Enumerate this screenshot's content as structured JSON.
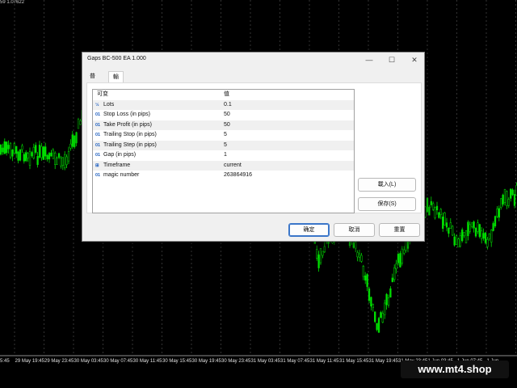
{
  "chart": {
    "top_readout": "59 1.07622",
    "time_labels": [
      "5:45",
      "29 May 19:45",
      "29 May 23:45",
      "30 May 03:45",
      "30 May 07:45",
      "30 May 11:45",
      "30 May 15:45",
      "30 May 19:45",
      "30 May 23:45",
      "31 May 03:45",
      "31 May 07:45",
      "31 May 11:45",
      "31 May 15:45",
      "31 May 19:45",
      "31 May 23:45",
      "1 Jun 03:45",
      "1 Jun 07:45",
      "1 Jun"
    ],
    "bull_color": "#00e000"
  },
  "watermark": "www.mt4.shop",
  "dialog": {
    "title": "Gaps BC-500 EA 1.000",
    "controls": {
      "minimize": "—",
      "maximize": "☐",
      "close": "✕"
    },
    "tabs": [
      "普通",
      "輸入"
    ],
    "active_tab": "輸入",
    "columns": {
      "variable": "可变",
      "value": "值"
    },
    "params": [
      {
        "icon": "½",
        "icon_name": "double-icon",
        "name": "Lots",
        "value": "0.1"
      },
      {
        "icon": "01",
        "icon_name": "integer-icon",
        "name": "Stop Loss (in pips)",
        "value": "50"
      },
      {
        "icon": "01",
        "icon_name": "integer-icon",
        "name": "Take Profit (in pips)",
        "value": "50"
      },
      {
        "icon": "01",
        "icon_name": "integer-icon",
        "name": "Trailing Stop (in pips)",
        "value": "5"
      },
      {
        "icon": "01",
        "icon_name": "integer-icon",
        "name": "Trailing Step (in pips)",
        "value": "5"
      },
      {
        "icon": "01",
        "icon_name": "integer-icon",
        "name": "Gap (in pips)",
        "value": "1"
      },
      {
        "icon": "⊞",
        "icon_name": "enum-icon",
        "name": "Timeframe",
        "value": "current"
      },
      {
        "icon": "01",
        "icon_name": "integer-icon",
        "name": "magic number",
        "value": "263864916"
      }
    ],
    "buttons": {
      "load": "載入(L)",
      "save": "保存(S)",
      "ok": "确定",
      "cancel": "取消",
      "reset": "重置"
    }
  }
}
